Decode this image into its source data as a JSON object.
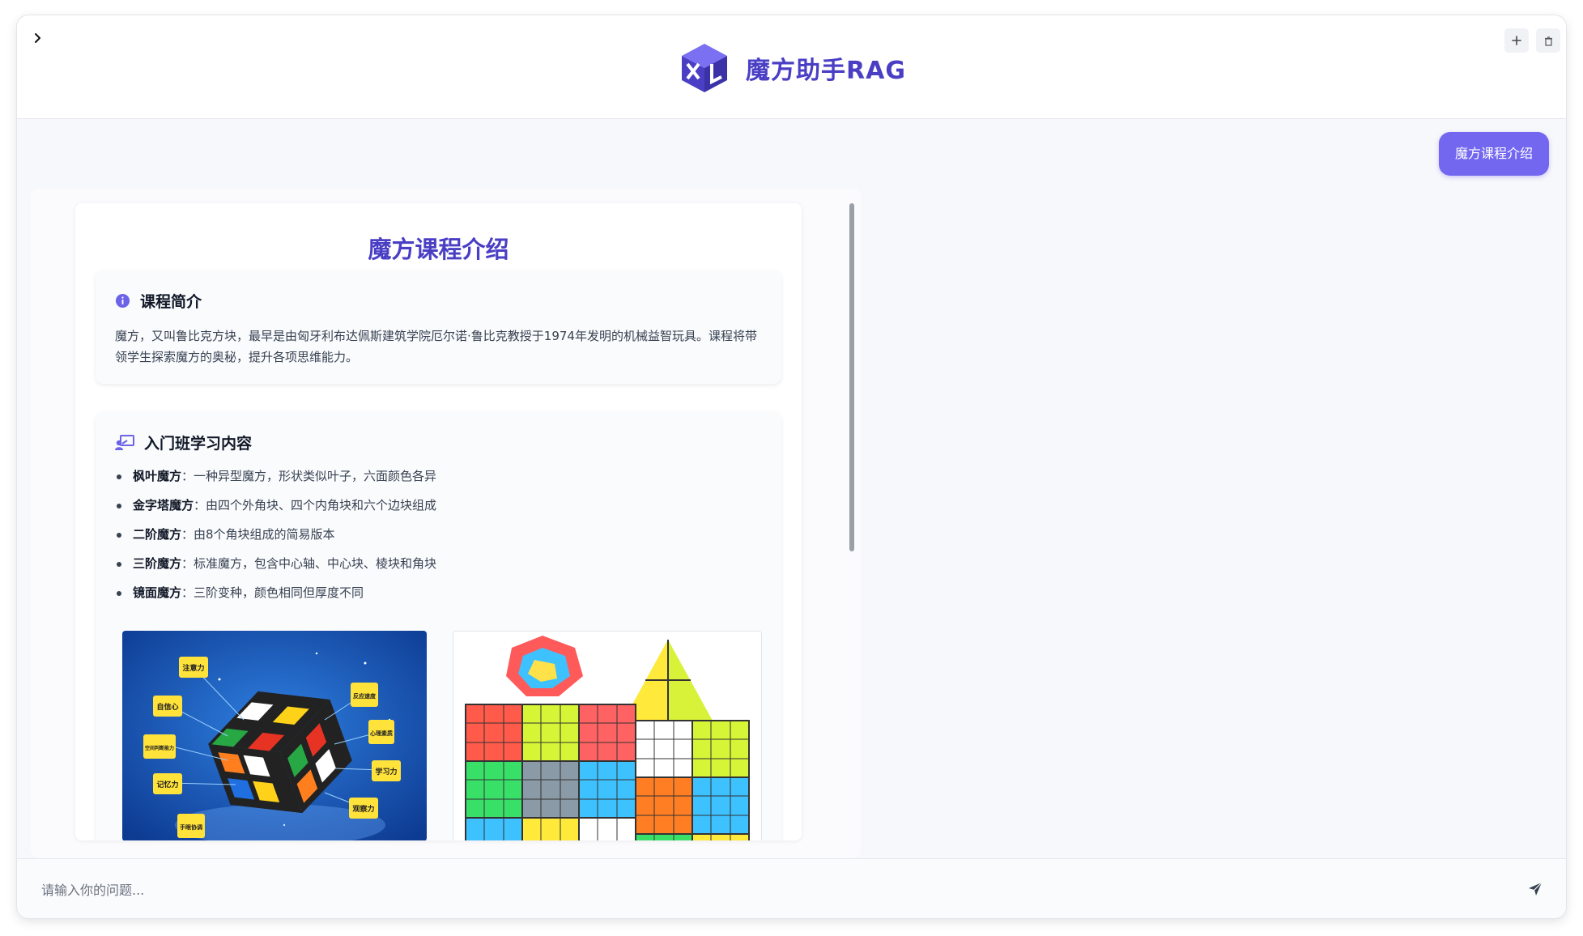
{
  "app": {
    "title": "魔方助手RAG"
  },
  "header": {
    "new_chat_icon": "plus-icon",
    "clear_icon": "trash-icon",
    "toggle_icon": "chevron-right-icon"
  },
  "chat": {
    "user_message": "魔方课程介绍",
    "answer": {
      "title": "魔方课程介绍",
      "intro": {
        "heading": "课程简介",
        "icon": "info-icon",
        "text": "魔方，又叫鲁比克方块，最早是由匈牙利布达佩斯建筑学院厄尔诺·鲁比克教授于1974年发明的机械益智玩具。课程将带领学生探索魔方的奥秘，提升各项思维能力。"
      },
      "beginner": {
        "heading": "入门班学习内容",
        "icon": "teacher-icon",
        "items": [
          {
            "name": "枫叶魔方",
            "desc": "：一种异型魔方，形状类似叶子，六面颜色各异"
          },
          {
            "name": "金字塔魔方",
            "desc": "：由四个外角块、四个内角块和六个边块组成"
          },
          {
            "name": "二阶魔方",
            "desc": "：由8个角块组成的简易版本"
          },
          {
            "name": "三阶魔方",
            "desc": "：标准魔方，包含中心轴、中心块、棱块和角块"
          },
          {
            "name": "镜面魔方",
            "desc": "：三阶变种，颜色相同但厚度不同"
          }
        ]
      },
      "image1_labels": [
        "注意力",
        "反应速度",
        "自信心",
        "心理素质",
        "空间判断能力",
        "学习力",
        "记忆力",
        "观察力",
        "手眼协调"
      ]
    }
  },
  "input": {
    "placeholder": "请输入你的问题...",
    "send_icon": "send-icon"
  },
  "colors": {
    "accent": "#4a3fc4",
    "bubble": "#7367f0"
  }
}
